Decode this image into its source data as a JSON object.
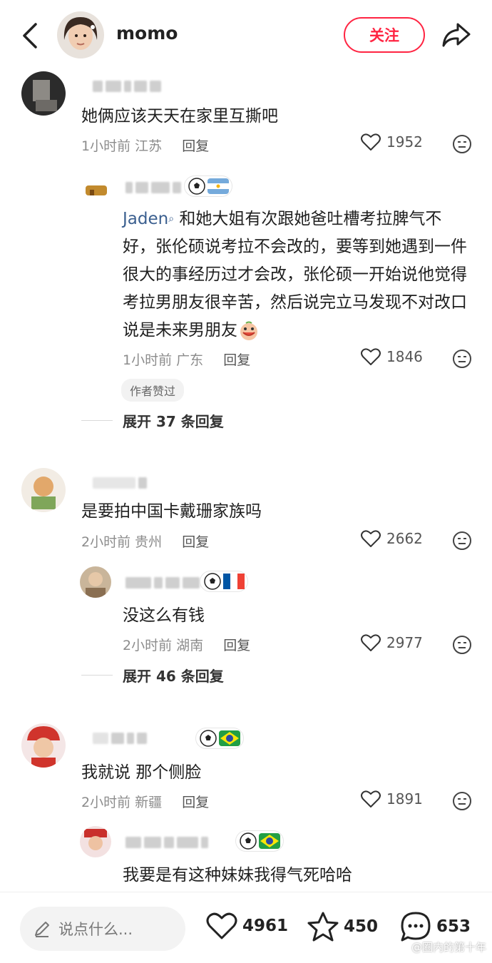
{
  "header": {
    "author_name": "momo",
    "follow_label": "关注"
  },
  "comments": [
    {
      "text": "她俩应该天天在家里互撕吧",
      "time": "1小时前",
      "location": "江苏",
      "reply_label": "回复",
      "likes": "1952",
      "reply": {
        "mention": "Jaden",
        "text": " 和她大姐有次跟她爸吐槽考拉脾气不好，张伦硕说考拉不会改的，要等到她遇到一件很大的事经历过才会改，张伦硕一开始说他觉得考拉男朋友很辛苦，然后说完立马发现不对改口说是未来男朋友",
        "time": "1小时前",
        "location": "广东",
        "reply_label": "回复",
        "likes": "1846",
        "badge": "作者赞过"
      },
      "expand_label": "展开 37 条回复"
    },
    {
      "text": "是要拍中国卡戴珊家族吗",
      "time": "2小时前",
      "location": "贵州",
      "reply_label": "回复",
      "likes": "2662",
      "reply": {
        "text": "没这么有钱",
        "time": "2小时前",
        "location": "湖南",
        "reply_label": "回复",
        "likes": "2977"
      },
      "expand_label": "展开 46 条回复"
    },
    {
      "text": "我就说 那个侧脸",
      "time": "2小时前",
      "location": "新疆",
      "reply_label": "回复",
      "likes": "1891",
      "reply": {
        "text": "我要是有这种妹妹我得气死哈哈"
      }
    }
  ],
  "bottom_bar": {
    "input_placeholder": "说点什么...",
    "likes": "4961",
    "favorites": "450",
    "comments": "653"
  },
  "watermark": "@圈内的第十年",
  "colors": {
    "accent": "#ff2442",
    "mention": "#3b5f8f"
  }
}
